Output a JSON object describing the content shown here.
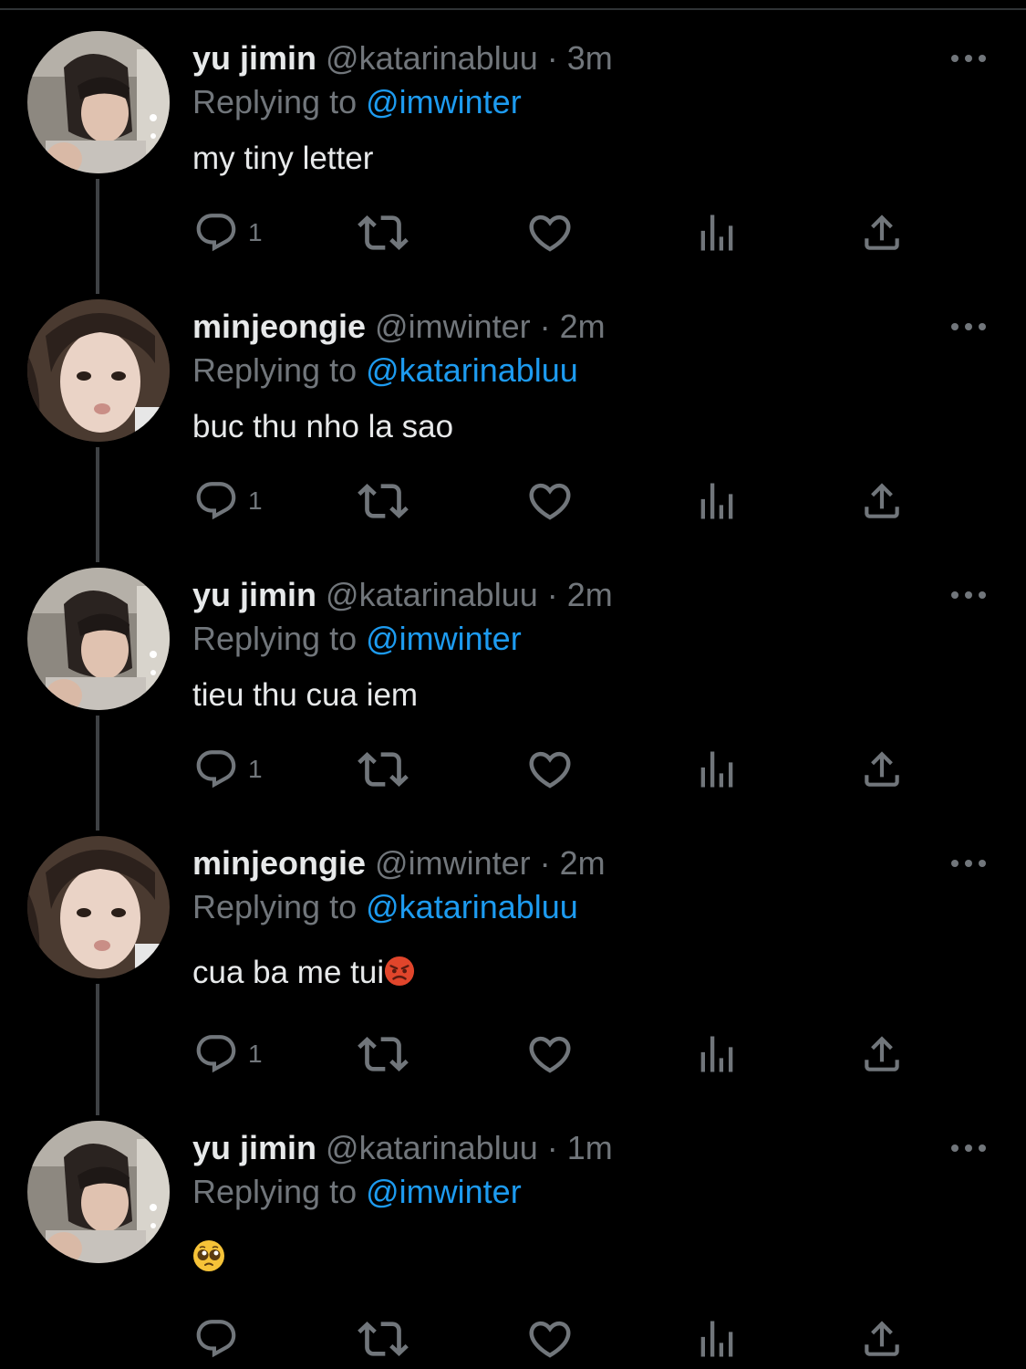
{
  "colors": {
    "background": "#000000",
    "primary_text": "#e7e9ea",
    "secondary_text": "#71767b",
    "link": "#1d9bf0",
    "thread_line": "#3e4144"
  },
  "icons": {
    "more": "more-horizontal-icon",
    "reply": "reply-icon",
    "retweet": "retweet-icon",
    "like": "heart-icon",
    "views": "views-icon",
    "share": "share-icon"
  },
  "tweets": [
    {
      "name": "yu jimin",
      "handle": "@katarinabluu",
      "separator": "·",
      "time": "3m",
      "replying_prefix": "Replying to",
      "replying_handle": "@imwinter",
      "text": "my tiny letter",
      "reply_count": "1"
    },
    {
      "name": "minjeongie",
      "handle": "@imwinter",
      "separator": "·",
      "time": "2m",
      "replying_prefix": "Replying to",
      "replying_handle": "@katarinabluu",
      "text": "buc thu nho la sao",
      "reply_count": "1"
    },
    {
      "name": "yu jimin",
      "handle": "@katarinabluu",
      "separator": "·",
      "time": "2m",
      "replying_prefix": "Replying to",
      "replying_handle": "@imwinter",
      "text": "tieu thu cua iem",
      "reply_count": "1"
    },
    {
      "name": "minjeongie",
      "handle": "@imwinter",
      "separator": "·",
      "time": "2m",
      "replying_prefix": "Replying to",
      "replying_handle": "@katarinabluu",
      "text": "cua ba me tui",
      "reply_count": "1"
    },
    {
      "name": "yu jimin",
      "handle": "@katarinabluu",
      "separator": "·",
      "time": "1m",
      "replying_prefix": "Replying to",
      "replying_handle": "@imwinter",
      "text": "",
      "reply_count": ""
    }
  ]
}
